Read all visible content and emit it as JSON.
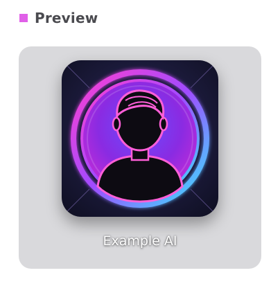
{
  "header": {
    "title": "Preview",
    "accent_color": "#e060e8",
    "icon": "square-icon"
  },
  "preview": {
    "caption": "Example AI",
    "avatar_icon": "person-avatar-icon",
    "card_color": "#d9d9dc"
  }
}
